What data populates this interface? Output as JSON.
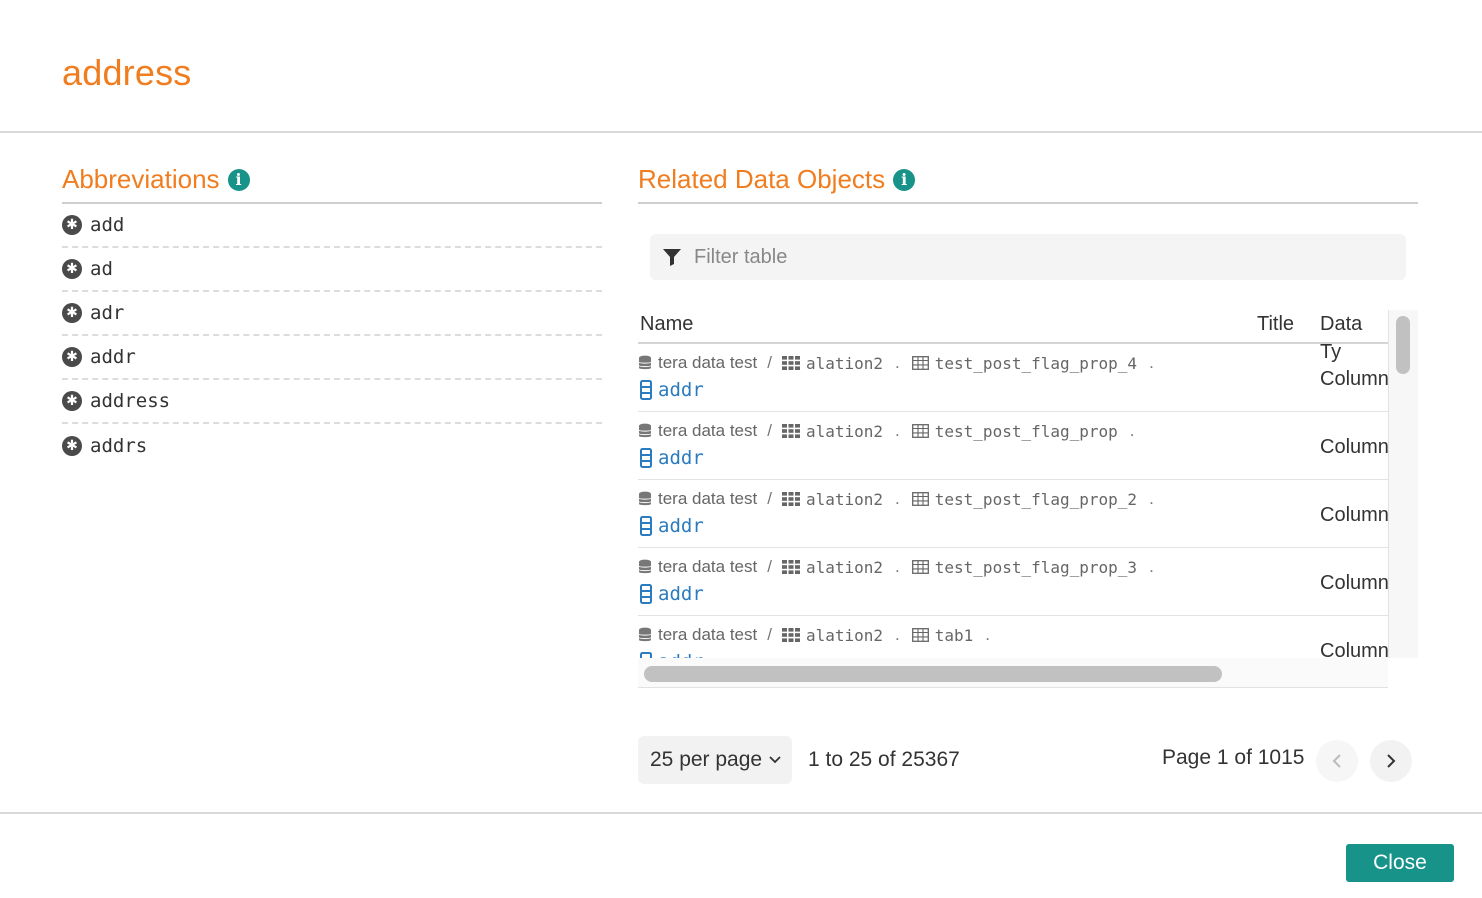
{
  "dialog": {
    "title": "address"
  },
  "abbreviations": {
    "heading": "Abbreviations",
    "items": [
      "add",
      "ad",
      "adr",
      "addr",
      "address",
      "addrs"
    ]
  },
  "related": {
    "heading": "Related Data Objects",
    "filter_placeholder": "Filter table",
    "columns": [
      "Name",
      "Title",
      "Data Ty"
    ],
    "rows": [
      {
        "datasource": "tera data test",
        "schema": "alation2",
        "table": "test_post_flag_prop_4",
        "column": "addr",
        "type": "Column"
      },
      {
        "datasource": "tera data test",
        "schema": "alation2",
        "table": "test_post_flag_prop",
        "column": "addr",
        "type": "Column"
      },
      {
        "datasource": "tera data test",
        "schema": "alation2",
        "table": "test_post_flag_prop_2",
        "column": "addr",
        "type": "Column"
      },
      {
        "datasource": "tera data test",
        "schema": "alation2",
        "table": "test_post_flag_prop_3",
        "column": "addr",
        "type": "Column"
      },
      {
        "datasource": "tera data test",
        "schema": "alation2",
        "table": "tab1",
        "column": "addr",
        "type": "Column"
      }
    ],
    "path_separator": "/",
    "path_dot": "."
  },
  "pagination": {
    "per_page": "25 per page",
    "range": "1 to 25 of 25367",
    "page_info": "Page 1 of 1015"
  },
  "footer": {
    "close_label": "Close"
  },
  "colors": {
    "accent": "#f07d1f",
    "teal": "#17938a",
    "link": "#2a7bbf"
  },
  "icons": {
    "info": "info-icon",
    "abbreviation": "asterisk-circle-icon",
    "filter": "filter-icon",
    "datasource": "database-icon",
    "schema": "schema-grid-icon",
    "table": "table-icon",
    "column": "column-icon",
    "prev": "chevron-left-icon",
    "next": "chevron-right-icon",
    "dropdown": "chevron-down-icon"
  }
}
